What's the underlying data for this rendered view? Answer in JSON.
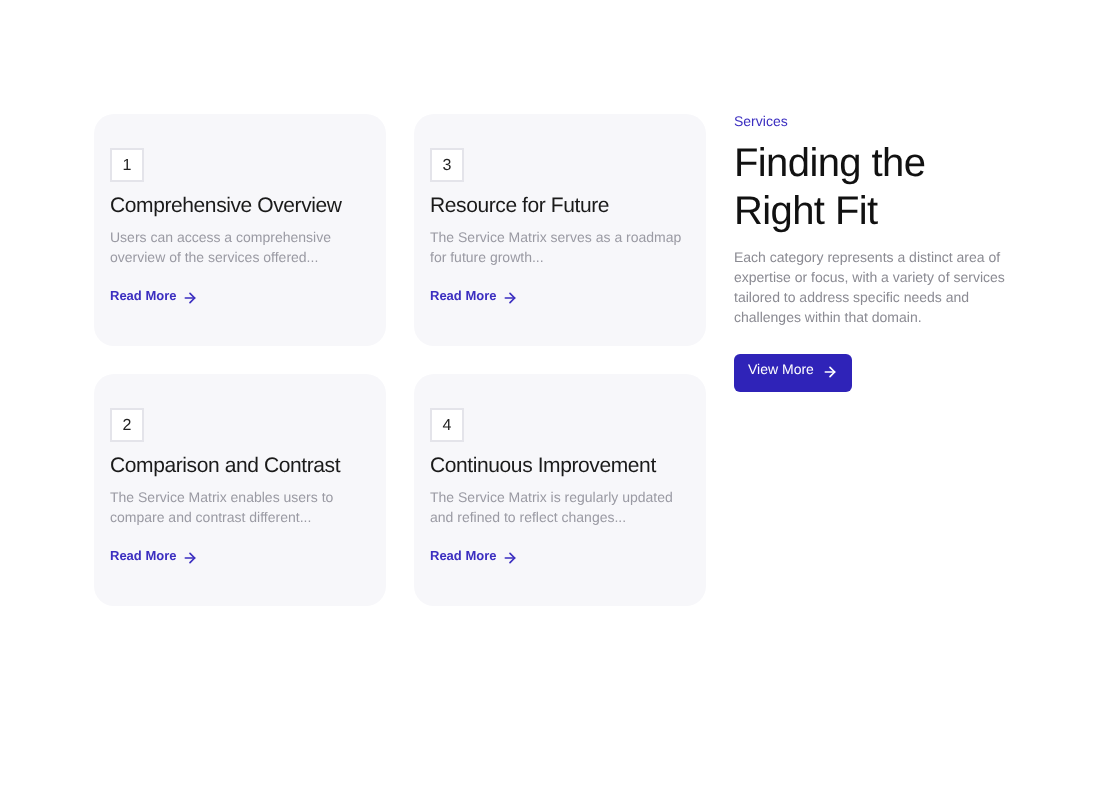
{
  "cards": [
    {
      "number": "1",
      "title": "Comprehensive Overview",
      "description": "Users can access a comprehensive overview of the services offered...",
      "link": "Read More"
    },
    {
      "number": "3",
      "title": "Resource for Future",
      "description": "The Service Matrix serves as a roadmap for future growth...",
      "link": "Read More"
    },
    {
      "number": "2",
      "title": "Comparison and Contrast",
      "description": "The Service Matrix enables users to compare and contrast different...",
      "link": "Read More"
    },
    {
      "number": "4",
      "title": "Continuous Improvement",
      "description": "The Service Matrix is regularly updated and refined to reflect changes...",
      "link": "Read More"
    }
  ],
  "intro": {
    "eyebrow": "Services",
    "heading": "Finding the Right Fit",
    "text": "Each category represents a distinct area of expertise or focus, with a variety of services tailored to address specific needs and challenges within that domain.",
    "button": "View More"
  }
}
